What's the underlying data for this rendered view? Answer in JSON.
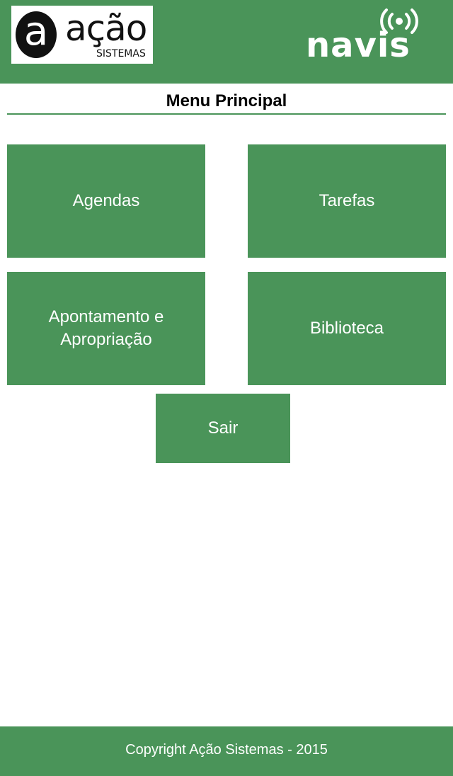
{
  "header": {
    "left_logo": {
      "mark": "a",
      "word": "ação",
      "sub": "SISTEMAS"
    },
    "right_logo": {
      "word": "navis",
      "icon": "wireless-signal-icon"
    },
    "background_color": "#4a9459"
  },
  "main": {
    "title": "Menu Principal",
    "menu": {
      "agendas": "Agendas",
      "tarefas": "Tarefas",
      "apontamento": "Apontamento e Apropriação",
      "biblioteca": "Biblioteca",
      "sair": "Sair"
    }
  },
  "footer": {
    "text": "Copyright Ação Sistemas - 2015"
  },
  "colors": {
    "accent": "#4a9459",
    "text_on_accent": "#ffffff",
    "background": "#ffffff"
  }
}
